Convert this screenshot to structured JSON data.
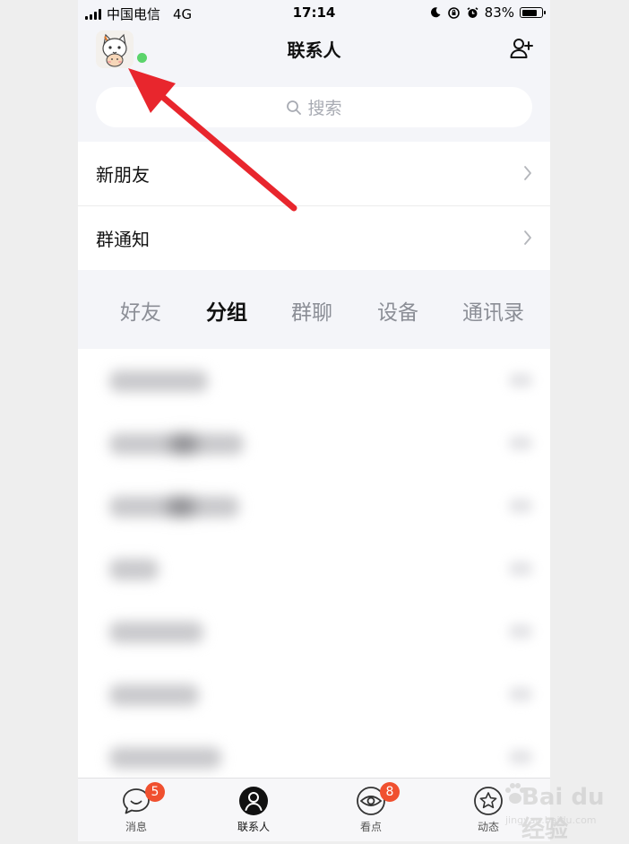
{
  "status_bar": {
    "carrier": "中国电信",
    "network": "4G",
    "time": "17:14",
    "battery": "83%",
    "battery_level": 0.83
  },
  "header": {
    "title": "联系人"
  },
  "search": {
    "placeholder": "搜索"
  },
  "menu": [
    {
      "label": "新朋友"
    },
    {
      "label": "群通知"
    }
  ],
  "tabs": [
    {
      "label": "好友",
      "active": false
    },
    {
      "label": "分组",
      "active": true
    },
    {
      "label": "群聊",
      "active": false
    },
    {
      "label": "设备",
      "active": false
    },
    {
      "label": "通讯录",
      "active": false
    }
  ],
  "tab_bar": [
    {
      "label": "消息",
      "icon": "chat-bubble-icon",
      "badge": "5"
    },
    {
      "label": "联系人",
      "icon": "person-icon",
      "badge": ""
    },
    {
      "label": "看点",
      "icon": "eye-icon",
      "badge": "8"
    },
    {
      "label": "动态",
      "icon": "star-icon",
      "badge": ""
    }
  ],
  "colors": {
    "accent_badge": "#f0502f",
    "online": "#5bd46b",
    "annotation_arrow": "#e8262d"
  },
  "watermark": {
    "logo": "Bai du 经验",
    "url": "jingyan.baidu.com"
  }
}
